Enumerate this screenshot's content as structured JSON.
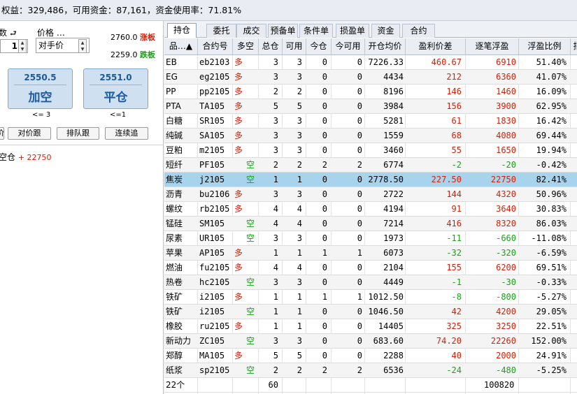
{
  "topbar": {
    "text": "权益：329,486，可用资金：87,161，资金使用率：71.81%"
  },
  "order_panel": {
    "qty_label_suffix": "数",
    "price_label": "价格 …",
    "qty_value": "1",
    "price_type": "对手价",
    "up_limit": "2760.0",
    "up_limit_tag": "涨板",
    "down_limit": "2259.0",
    "down_limit_tag": "跌板",
    "open_short": {
      "price": "2550.5",
      "label": "加空",
      "limit": "<= 3"
    },
    "close_pos": {
      "price": "2551.0",
      "label": "平仓",
      "limit": "<=1"
    },
    "buttons": [
      "价",
      "对价跟",
      "排队跟",
      "连续追"
    ],
    "position_note_label": "空仓",
    "position_note_value": "+ 22750"
  },
  "tabs": [
    "持仓",
    "委托",
    "成交",
    "预备单",
    "条件单",
    "损盈单",
    "资金",
    "合约"
  ],
  "active_tab": 0,
  "columns": [
    "品…▲",
    "合约号",
    "多空",
    "总仓",
    "可用",
    "今仓",
    "今可用",
    "开仓均价",
    "盈利价差",
    "逐笔浮盈",
    "浮盈比例",
    "指"
  ],
  "rows": [
    [
      "EB",
      "eb2103",
      "多",
      "3",
      "3",
      "0",
      "0",
      "7226.33",
      "460.67",
      "6910",
      "51.40%"
    ],
    [
      "EG",
      "eg2105",
      "多",
      "3",
      "3",
      "0",
      "0",
      "4434",
      "212",
      "6360",
      "41.07%"
    ],
    [
      "PP",
      "pp2105",
      "多",
      "2",
      "2",
      "0",
      "0",
      "8196",
      "146",
      "1460",
      "16.09%"
    ],
    [
      "PTA",
      "TA105",
      "多",
      "5",
      "5",
      "0",
      "0",
      "3984",
      "156",
      "3900",
      "62.95%"
    ],
    [
      "白糖",
      "SR105",
      "多",
      "3",
      "3",
      "0",
      "0",
      "5281",
      "61",
      "1830",
      "16.42%"
    ],
    [
      "纯碱",
      "SA105",
      "多",
      "3",
      "3",
      "0",
      "0",
      "1559",
      "68",
      "4080",
      "69.44%"
    ],
    [
      "豆粕",
      "m2105",
      "多",
      "3",
      "3",
      "0",
      "0",
      "3460",
      "55",
      "1650",
      "19.94%"
    ],
    [
      "短纤",
      "PF105",
      "空",
      "2",
      "2",
      "2",
      "2",
      "6774",
      "-2",
      "-20",
      "-0.42%"
    ],
    [
      "焦炭",
      "j2105",
      "空",
      "1",
      "1",
      "0",
      "0",
      "2778.50",
      "227.50",
      "22750",
      "82.41%"
    ],
    [
      "沥青",
      "bu2106",
      "多",
      "3",
      "3",
      "0",
      "0",
      "2722",
      "144",
      "4320",
      "50.96%"
    ],
    [
      "螺纹",
      "rb2105",
      "多",
      "4",
      "4",
      "0",
      "0",
      "4194",
      "91",
      "3640",
      "30.83%"
    ],
    [
      "锰硅",
      "SM105",
      "空",
      "4",
      "4",
      "0",
      "0",
      "7214",
      "416",
      "8320",
      "86.03%"
    ],
    [
      "尿素",
      "UR105",
      "空",
      "3",
      "3",
      "0",
      "0",
      "1973",
      "-11",
      "-660",
      "-11.08%"
    ],
    [
      "苹果",
      "AP105",
      "多",
      "1",
      "1",
      "1",
      "1",
      "6073",
      "-32",
      "-320",
      "-6.59%"
    ],
    [
      "燃油",
      "fu2105",
      "多",
      "4",
      "4",
      "0",
      "0",
      "2104",
      "155",
      "6200",
      "69.51%"
    ],
    [
      "热卷",
      "hc2105",
      "空",
      "3",
      "3",
      "0",
      "0",
      "4449",
      "-1",
      "-30",
      "-0.33%"
    ],
    [
      "铁矿",
      "i2105",
      "多",
      "1",
      "1",
      "1",
      "1",
      "1012.50",
      "-8",
      "-800",
      "-5.27%"
    ],
    [
      "铁矿",
      "i2105",
      "空",
      "1",
      "1",
      "0",
      "0",
      "1046.50",
      "42",
      "4200",
      "29.05%"
    ],
    [
      "橡胶",
      "ru2105",
      "多",
      "1",
      "1",
      "0",
      "0",
      "14405",
      "325",
      "3250",
      "22.51%"
    ],
    [
      "新动力",
      "ZC105",
      "空",
      "3",
      "3",
      "0",
      "0",
      "683.60",
      "74.20",
      "22260",
      "152.00%"
    ],
    [
      "郑醇",
      "MA105",
      "多",
      "5",
      "5",
      "0",
      "0",
      "2288",
      "40",
      "2000",
      "24.91%"
    ],
    [
      "纸浆",
      "sp2105",
      "空",
      "2",
      "2",
      "2",
      "2",
      "6536",
      "-24",
      "-480",
      "-5.25%"
    ]
  ],
  "selected_row": 8,
  "footer": {
    "count": "22个",
    "total_pos": "60",
    "total_float": "100820"
  },
  "colors": {
    "red": "#d81e06",
    "green": "#18a018",
    "selected": "#a8d3ec"
  }
}
